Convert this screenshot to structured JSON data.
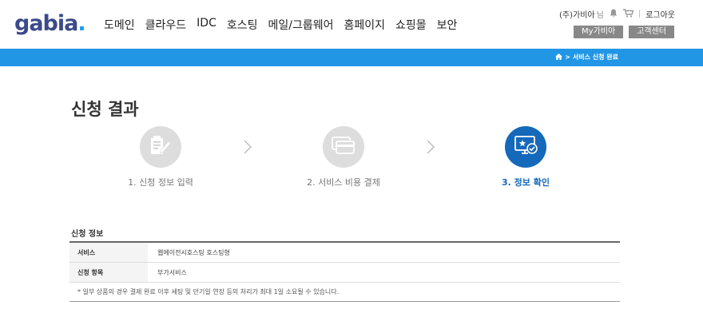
{
  "header": {
    "logo_text": "gabia",
    "logo_dot": ".",
    "nav": [
      "도메인",
      "클라우드",
      "IDC",
      "호스팅",
      "메일/그룹웨어",
      "홈페이지",
      "쇼핑몰",
      "보안"
    ],
    "user_name": "(주)가비아",
    "user_suffix": "님",
    "logout": "로그아웃",
    "my_gabia": "My가비아",
    "support": "고객센터"
  },
  "breadcrumb": {
    "separator": ">",
    "current": "서비스 신청 완료"
  },
  "page_title": "신청 결과",
  "steps": [
    {
      "label": "1. 신청 정보 입력",
      "icon": "form-edit-icon",
      "active": false
    },
    {
      "label": "2. 서비스 비용 결제",
      "icon": "payment-card-icon",
      "active": false
    },
    {
      "label": "3. 정보 확인",
      "icon": "monitor-check-icon",
      "active": true
    }
  ],
  "info": {
    "title": "신청 정보",
    "rows": [
      {
        "label": "서비스",
        "value": "웹에이전시호스팅 호스팅형"
      },
      {
        "label": "신청 항목",
        "value": "부가서비스"
      }
    ],
    "note": "* 일부 상품의 경우 결제 완료 이후 세팅 및 만기일 연장 등의 처리가 최대 1일 소요될 수 있습니다."
  },
  "colors": {
    "accent": "#2196e5",
    "active_step": "#1569ba",
    "inactive_step": "#dddddd"
  }
}
